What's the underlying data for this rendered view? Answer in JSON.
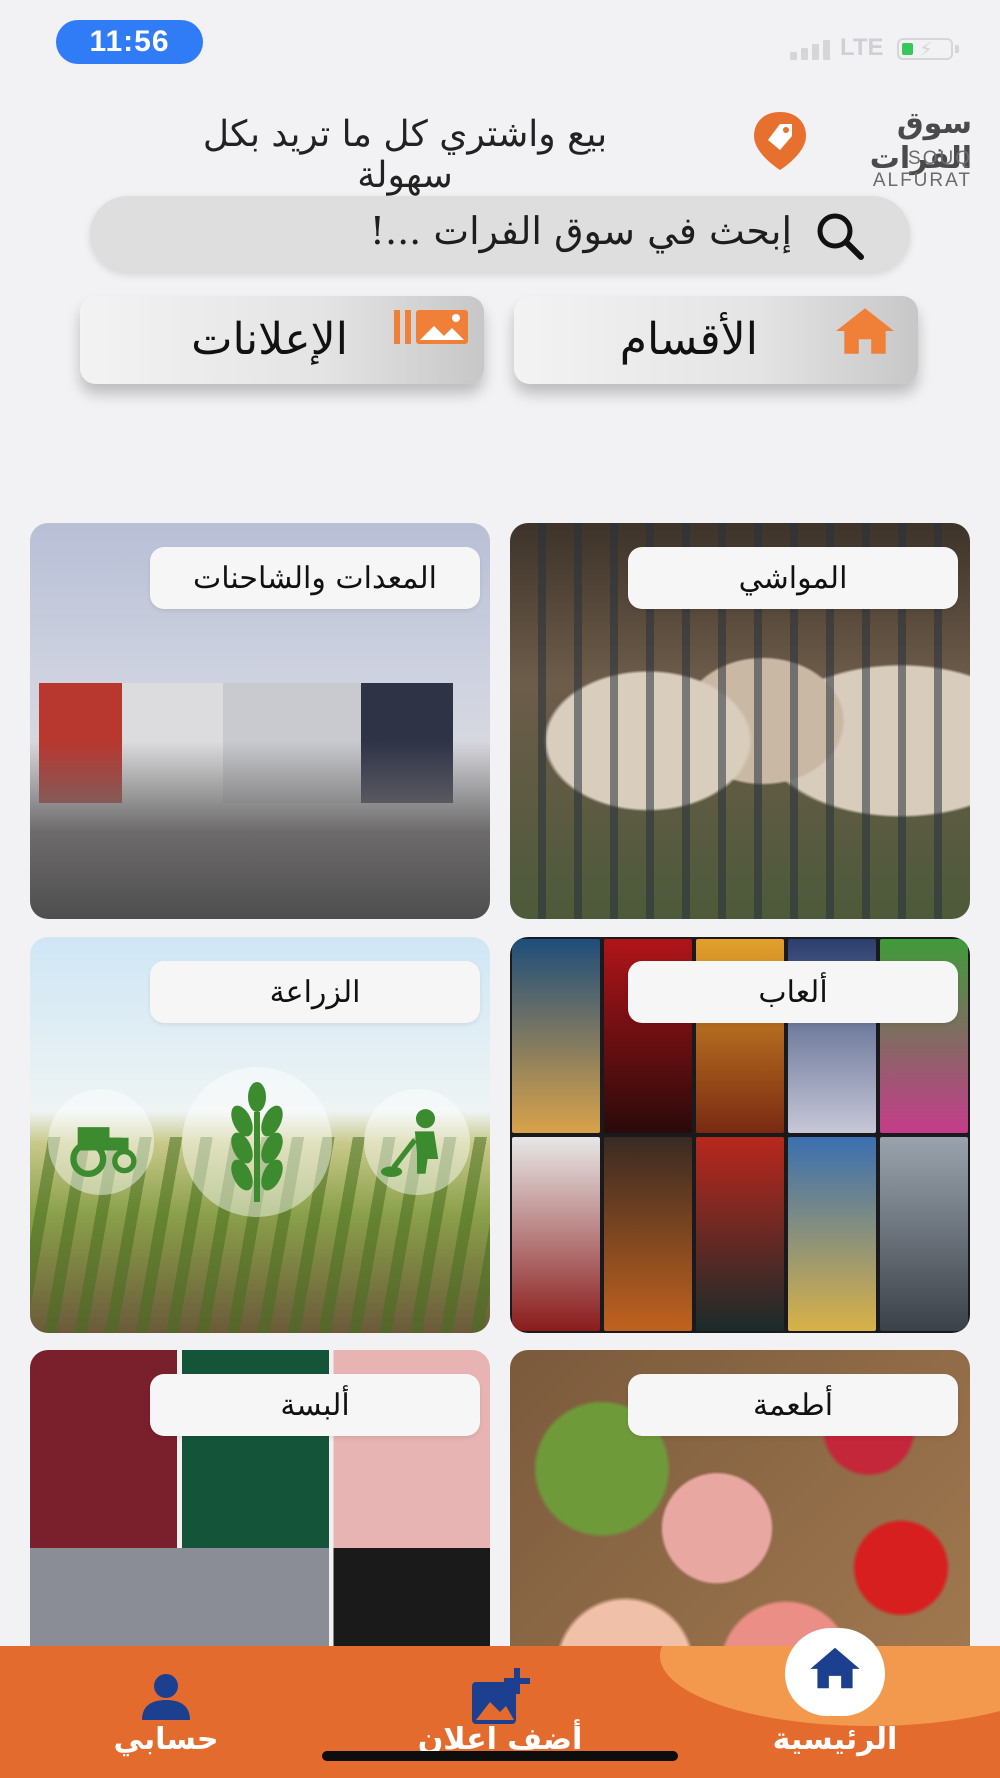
{
  "status_bar": {
    "time": "11:56",
    "network": "LTE"
  },
  "header": {
    "logo_ar": "سوق الفرات",
    "logo_en": "SOUQ ALFURAT",
    "tagline": "بيع واشتري كل ما تريد بكل سهولة"
  },
  "search": {
    "placeholder": "إبحث في سوق الفرات ...!"
  },
  "nav": {
    "sections_label": "الأقسام",
    "ads_label": "الإعلانات"
  },
  "categories": [
    {
      "label": "المواشي"
    },
    {
      "label": "المعدات والشاحنات"
    },
    {
      "label": "ألعاب"
    },
    {
      "label": "الزراعة"
    },
    {
      "label": "أطعمة"
    },
    {
      "label": "ألبسة"
    }
  ],
  "bottom_nav": {
    "home": "الرئيسية",
    "add_ad": "أضف اعلان",
    "account": "حسابي"
  },
  "colors": {
    "accent": "#e46b2e",
    "home_icon": "#1d3f8f",
    "search_bar": "#dedede"
  }
}
